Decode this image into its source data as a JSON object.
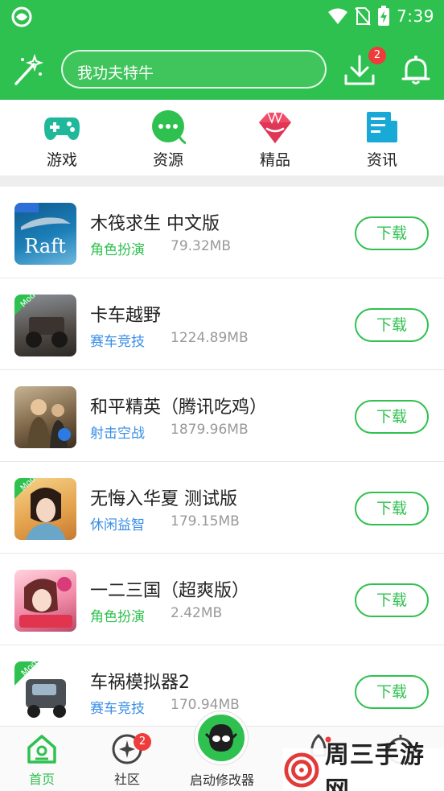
{
  "status": {
    "time": "7:39"
  },
  "header": {
    "search_placeholder": "我功夫特牛",
    "download_badge": "2"
  },
  "categories": [
    {
      "label": "游戏",
      "icon": "gamepad-icon"
    },
    {
      "label": "资源",
      "icon": "chat-bubble-icon"
    },
    {
      "label": "精品",
      "icon": "gem-icon"
    },
    {
      "label": "资讯",
      "icon": "news-icon"
    }
  ],
  "games": [
    {
      "title": "木筏求生  中文版",
      "genre": "角色扮演",
      "size": "79.32MB",
      "thumb_text": "Raft",
      "corner": "",
      "button": "下载",
      "genre_color": "#2fc14f"
    },
    {
      "title": "卡车越野",
      "genre": "赛车竞技",
      "size": "1224.89MB",
      "thumb_text": "",
      "corner": "Mod",
      "button": "下载",
      "genre_color": "#3a8ee6"
    },
    {
      "title": "和平精英（腾讯吃鸡）",
      "genre": "射击空战",
      "size": "1879.96MB",
      "thumb_text": "",
      "corner": "",
      "button": "下载",
      "genre_color": "#3a8ee6"
    },
    {
      "title": "无悔入华夏  测试版",
      "genre": "休闲益智",
      "size": "179.15MB",
      "thumb_text": "",
      "corner": "Mod",
      "button": "下载",
      "genre_color": "#3a8ee6"
    },
    {
      "title": "一二三国（超爽版）",
      "genre": "角色扮演",
      "size": "2.42MB",
      "thumb_text": "",
      "corner": "",
      "button": "下载",
      "genre_color": "#2fc14f"
    },
    {
      "title": "车祸模拟器2",
      "genre": "赛车竞技",
      "size": "170.94MB",
      "thumb_text": "",
      "corner": "Mod",
      "button": "下载",
      "genre_color": "#3a8ee6"
    }
  ],
  "tabbar": {
    "home": "首页",
    "community": "社区",
    "community_badge": "2",
    "launcher": "启动修改器"
  },
  "watermark": {
    "text": "周三手游网"
  },
  "colors": {
    "brand": "#2fc14f",
    "badge": "#ef3b3b",
    "genre_blue": "#3a8ee6"
  }
}
